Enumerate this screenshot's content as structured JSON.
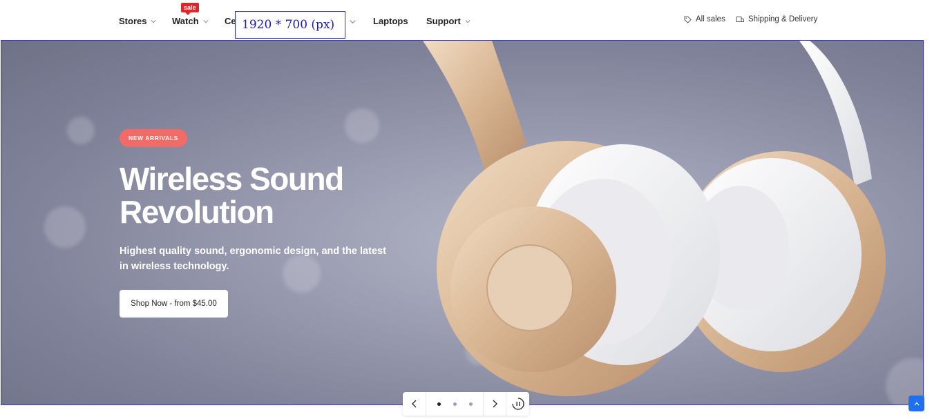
{
  "nav": {
    "items": [
      {
        "label": "Stores"
      },
      {
        "label": "Watch"
      },
      {
        "label": "Ce"
      },
      {
        "label": "Laptops"
      },
      {
        "label": "Support"
      }
    ],
    "sale_badge": "sale",
    "right_links": [
      {
        "label": "All sales",
        "icon": "tag-icon"
      },
      {
        "label": "Shipping & Delivery",
        "icon": "box-icon"
      }
    ]
  },
  "overlay": {
    "dimension_label": "1920 * 700 (px)"
  },
  "hero": {
    "badge": "NEW ARRIVALS",
    "title": "Wireless Sound Revolution",
    "subtitle": "Highest quality sound, ergonomic design, and the latest in wireless technology.",
    "cta": "Shop Now - from $45.00",
    "accent_color": "#f26b67"
  },
  "slider": {
    "slide_count": 3,
    "active_index": 0,
    "icons": [
      "chevron-left-icon",
      "chevron-right-icon",
      "pause-icon"
    ]
  },
  "scroll_top": {
    "icon": "arrow-up-icon",
    "color": "#1f6ff2"
  }
}
